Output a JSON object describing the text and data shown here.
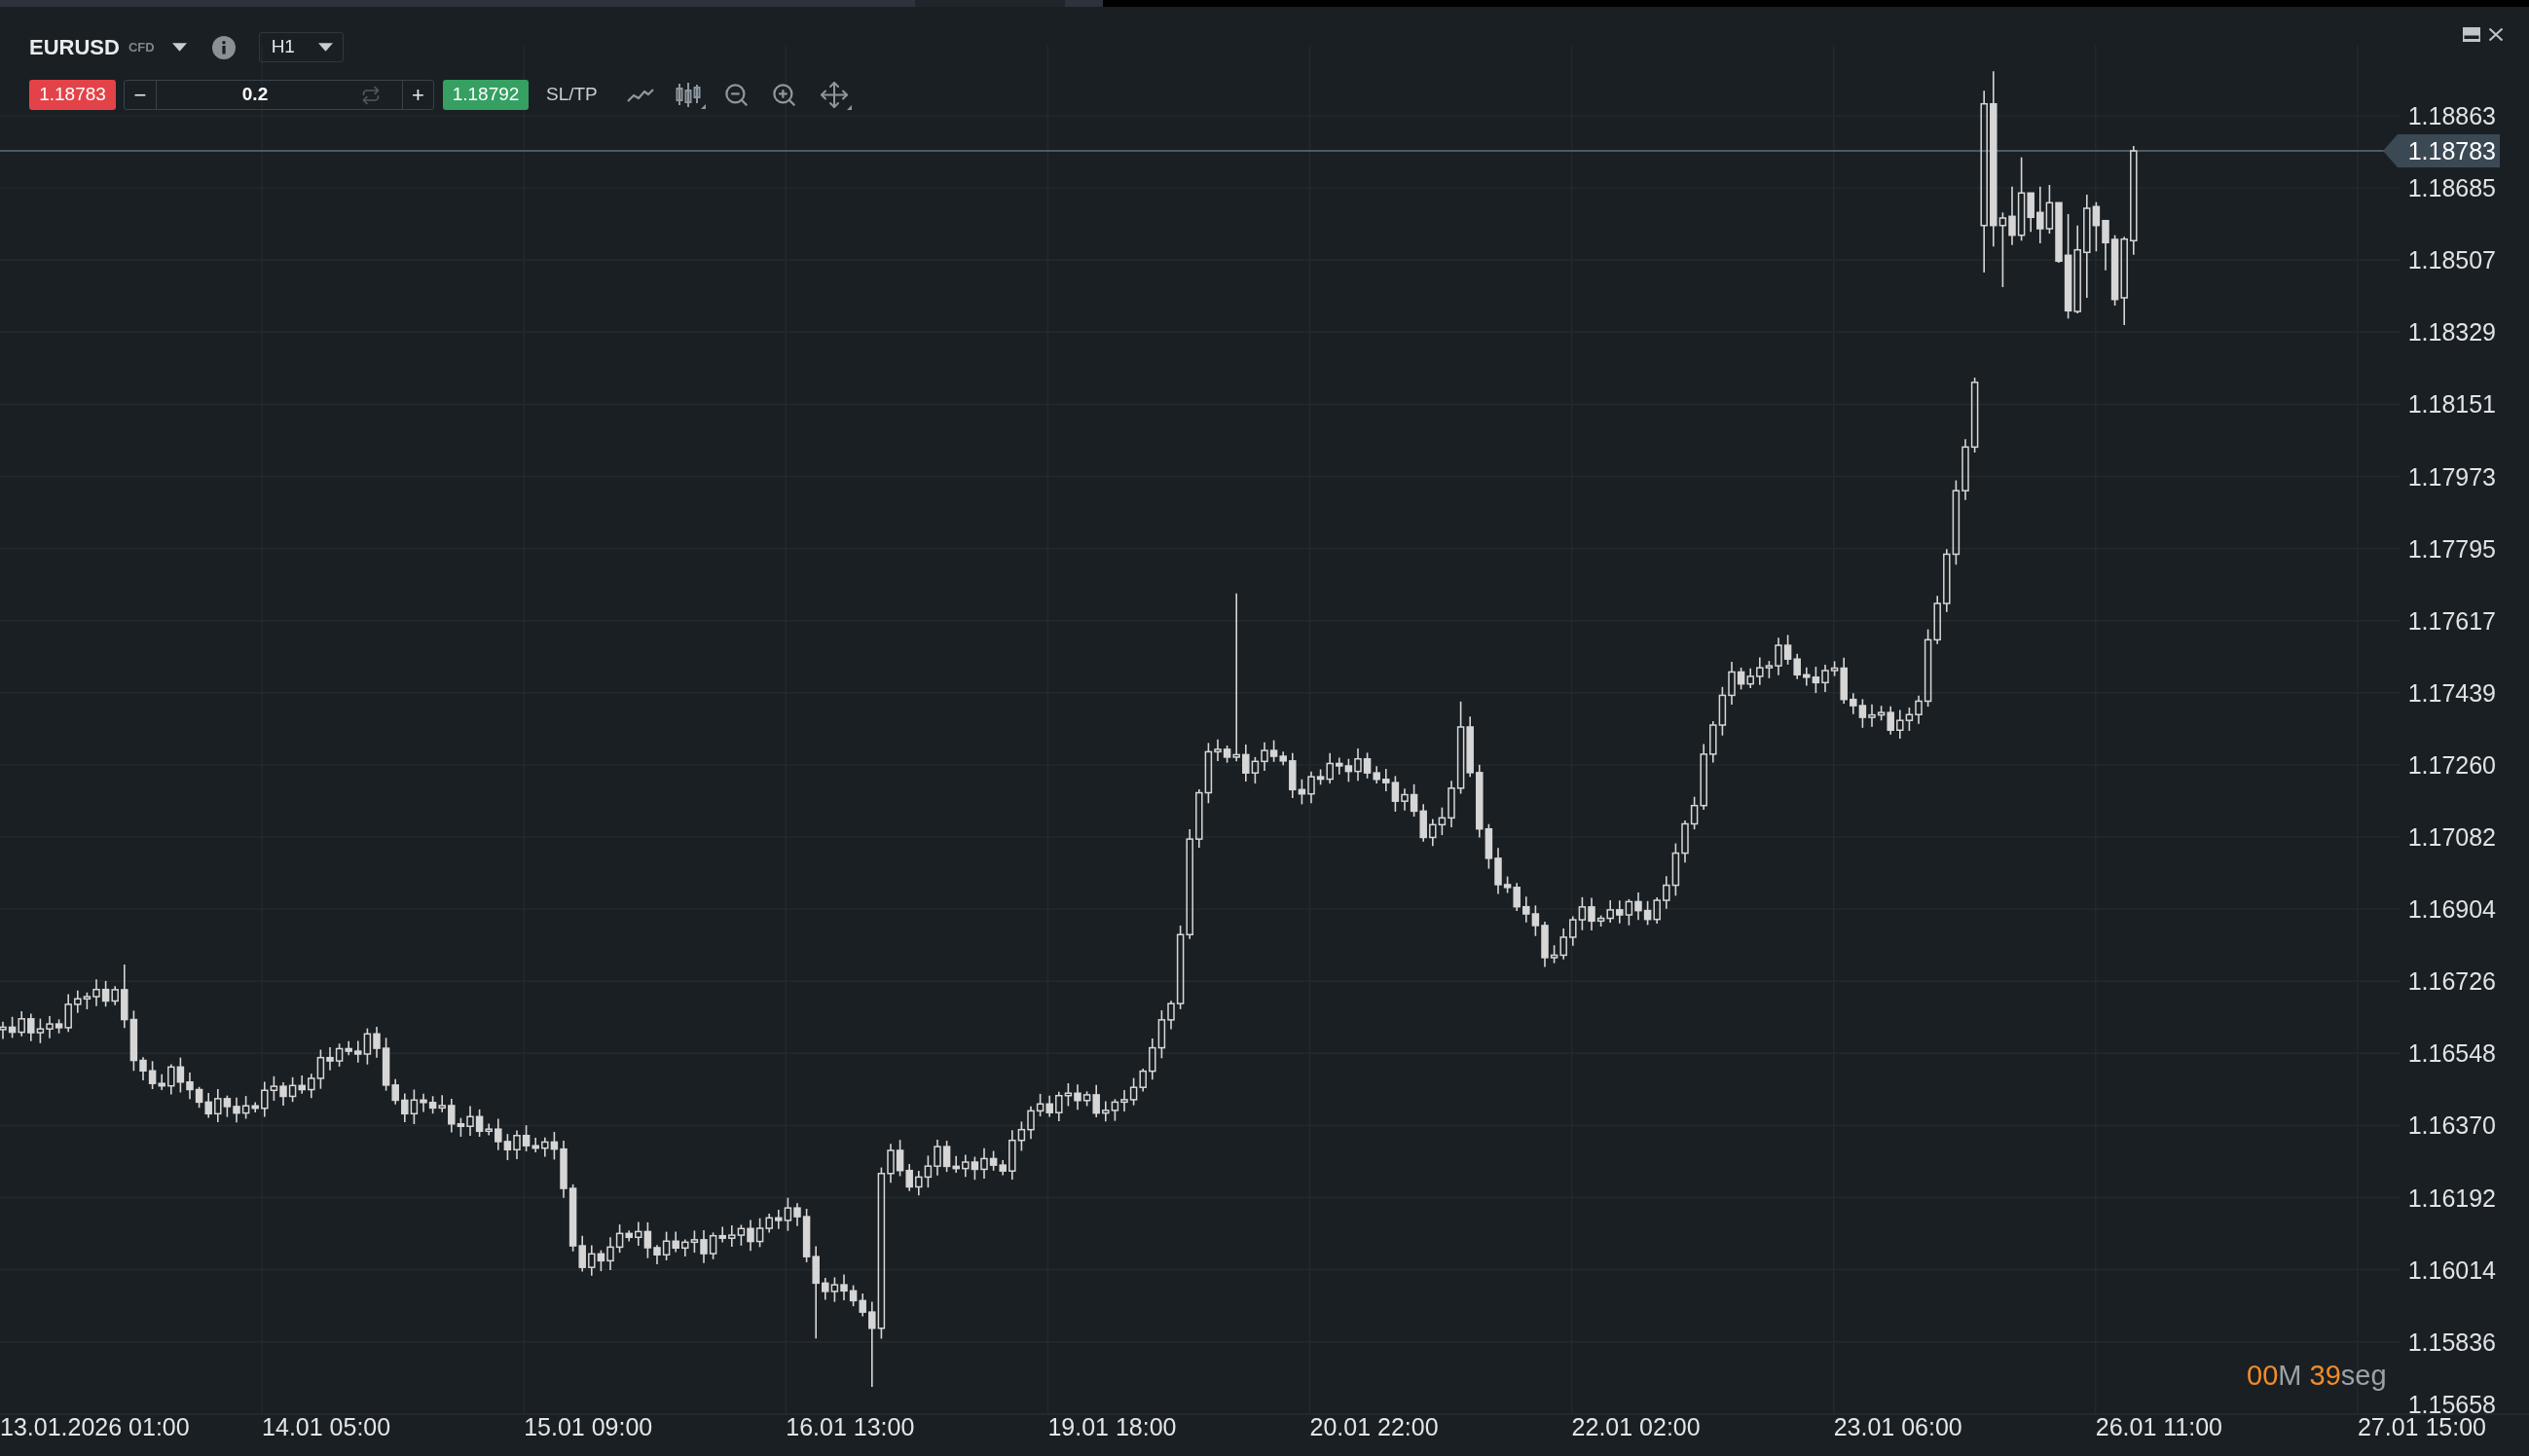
{
  "instrument": {
    "symbol": "EURUSD",
    "type_tag": "CFD"
  },
  "timeframe": {
    "label": "H1"
  },
  "order_bar": {
    "sell_price": "1.18783",
    "quantity": {
      "decrease": "−",
      "value": "0.2",
      "increase": "+"
    },
    "buy_price": "1.18792",
    "sl_tp": "SL/TP"
  },
  "price_axis": {
    "labels": [
      "1.18863",
      "1.18685",
      "1.18507",
      "1.18329",
      "1.18151",
      "1.17973",
      "1.17795",
      "1.17617",
      "1.17439",
      "1.17260",
      "1.17082",
      "1.16904",
      "1.16726",
      "1.16548",
      "1.16370",
      "1.16192",
      "1.16014",
      "1.15836",
      "1.15658"
    ],
    "current_price": "1.18783"
  },
  "time_axis": {
    "labels": [
      "13.01.2026 01:00",
      "14.01 05:00",
      "15.01 09:00",
      "16.01 13:00",
      "19.01 18:00",
      "20.01 22:00",
      "22.01 02:00",
      "23.01 06:00",
      "26.01 11:00",
      "27.01 15:00"
    ]
  },
  "countdown": {
    "minutes": "00",
    "minutes_unit": "M",
    "seconds": "39",
    "seconds_unit": "seg"
  }
}
